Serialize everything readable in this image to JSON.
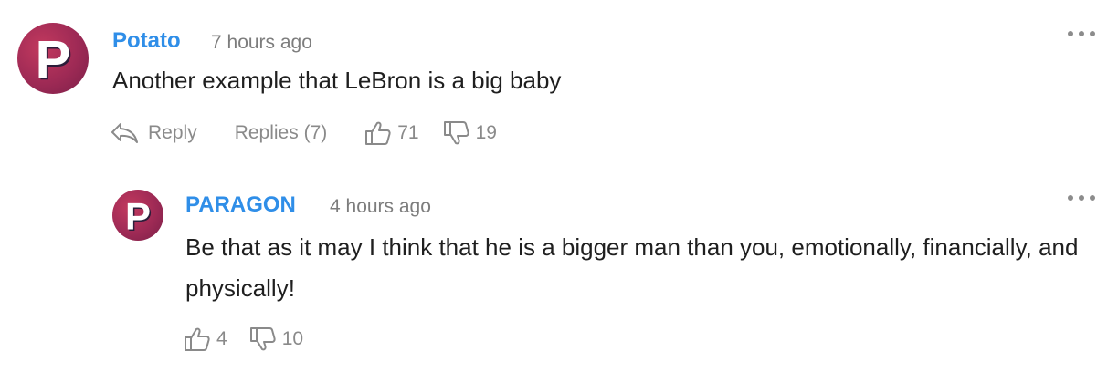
{
  "comments": [
    {
      "avatar_letter": "P",
      "author": "Potato",
      "time": "7 hours ago",
      "text": "Another example that LeBron is a big baby",
      "reply_label": "Reply",
      "replies_label": "Replies (7)",
      "likes": "71",
      "dislikes": "19"
    },
    {
      "avatar_letter": "P",
      "author": "PARAGON",
      "time": "4 hours ago",
      "text": "Be that as it may I think that he is a bigger man than you, emotionally, financially, and physically!",
      "likes": "4",
      "dislikes": "10"
    }
  ],
  "colors": {
    "author_link": "#2f8ee8",
    "avatar": "#9e2a55",
    "muted": "#8a8a8a"
  },
  "icons": {
    "more": "more-dots-icon",
    "reply": "reply-arrow-icon",
    "like": "thumbs-up-icon",
    "dislike": "thumbs-down-icon"
  }
}
